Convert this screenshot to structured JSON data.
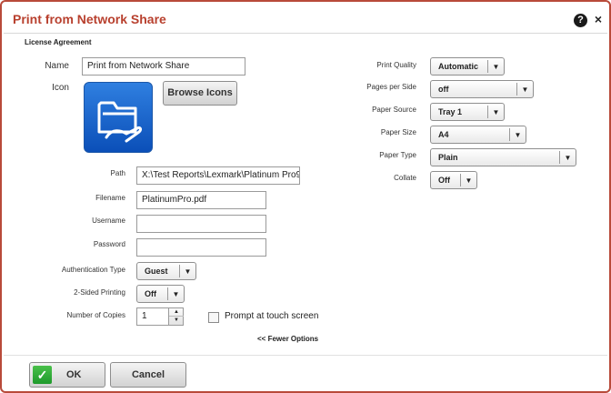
{
  "window": {
    "title": "Print from Network Share",
    "help_icon": "help-icon",
    "close_icon": "close-icon",
    "help_glyph": "?",
    "close_glyph": "×"
  },
  "section_label": "License Agreement",
  "form": {
    "name_label": "Name",
    "name_value": "Print from Network Share",
    "icon_label": "Icon",
    "browse_icons_label": "Browse Icons",
    "path_label": "Path",
    "path_value": "X:\\Test Reports\\Lexmark\\Platinum Pro9",
    "filename_label": "Filename",
    "filename_value": "PlatinumPro.pdf",
    "username_label": "Username",
    "username_value": "",
    "password_label": "Password",
    "password_value": "",
    "auth_type_label": "Authentication Type",
    "auth_type_value": "Guest",
    "two_sided_label": "2-Sided Printing",
    "two_sided_value": "Off",
    "copies_label": "Number of Copies",
    "copies_value": "1",
    "prompt_label": "Prompt at touch screen",
    "fewer_options_label": "<< Fewer Options"
  },
  "settings": {
    "print_quality_label": "Print Quality",
    "print_quality_value": "Automatic",
    "pages_per_side_label": "Pages per Side",
    "pages_per_side_value": "off",
    "paper_source_label": "Paper Source",
    "paper_source_value": "Tray 1",
    "paper_size_label": "Paper Size",
    "paper_size_value": "A4",
    "paper_type_label": "Paper Type",
    "paper_type_value": "Plain",
    "collate_label": "Collate",
    "collate_value": "Off"
  },
  "footer": {
    "ok_label": "OK",
    "cancel_label": "Cancel"
  },
  "colors": {
    "accent": "#b8402e",
    "ok_green": "#1f9a2c",
    "icon_blue": "#1565d8"
  },
  "icons": {
    "app_icon": "folder-hand-icon",
    "ok_icon": "checkmark-icon",
    "dropdown_arrow": "chevron-down-icon"
  }
}
